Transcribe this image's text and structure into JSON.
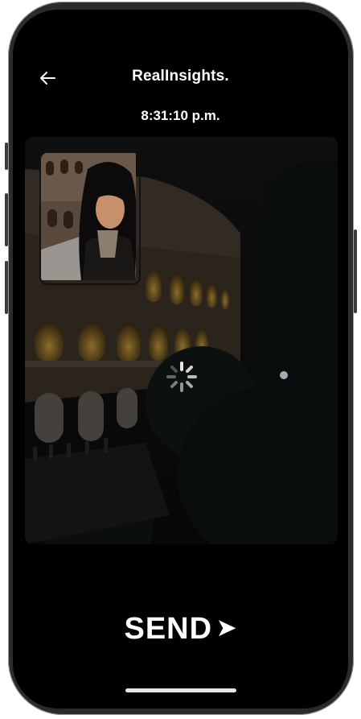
{
  "header": {
    "title": "RealInsights."
  },
  "capture": {
    "timestamp": "8:31:10 p.m."
  },
  "actions": {
    "send_label": "SEND",
    "send_arrow": "➤"
  },
  "icons": {
    "back": "arrow-left-icon",
    "spinner": "loading-spinner-icon"
  },
  "colors": {
    "background": "#000000",
    "text": "#ffffff"
  }
}
